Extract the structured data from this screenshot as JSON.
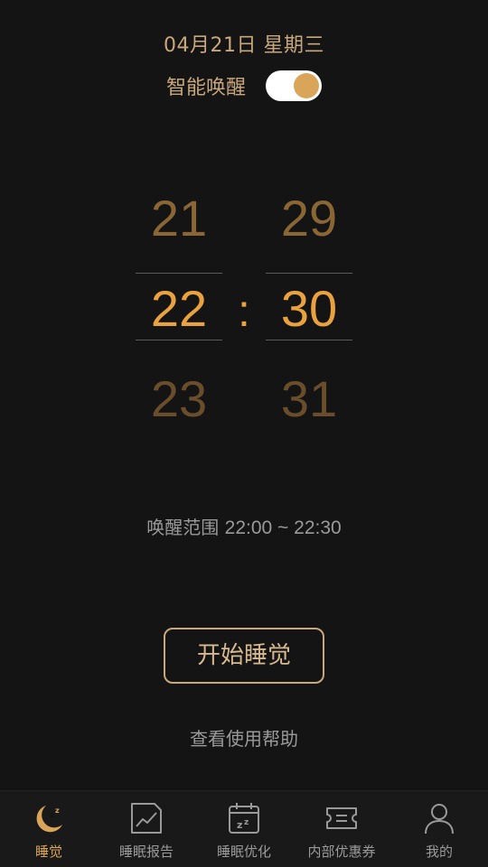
{
  "header": {
    "date": "04月21日 星期三",
    "smart_wake_label": "智能唤醒",
    "smart_wake_on": true
  },
  "picker": {
    "hours": {
      "prev": "21",
      "selected": "22",
      "next": "23"
    },
    "separator": ":",
    "minutes": {
      "prev": "29",
      "selected": "30",
      "next": "31"
    }
  },
  "wake_range": {
    "label": "唤醒范围",
    "value": "22:00 ~ 22:30"
  },
  "actions": {
    "start_label": "开始睡觉",
    "help_label": "查看使用帮助"
  },
  "tabs": [
    {
      "label": "睡觉",
      "icon": "moon-zz-icon",
      "active": true
    },
    {
      "label": "睡眠报告",
      "icon": "chart-report-icon",
      "active": false
    },
    {
      "label": "睡眠优化",
      "icon": "calendar-zz-icon",
      "active": false
    },
    {
      "label": "内部优惠券",
      "icon": "coupon-icon",
      "active": false
    },
    {
      "label": "我的",
      "icon": "person-icon",
      "active": false
    }
  ],
  "colors": {
    "background": "#141414",
    "accent": "#d9a559",
    "text_muted": "#9a9a9a"
  }
}
